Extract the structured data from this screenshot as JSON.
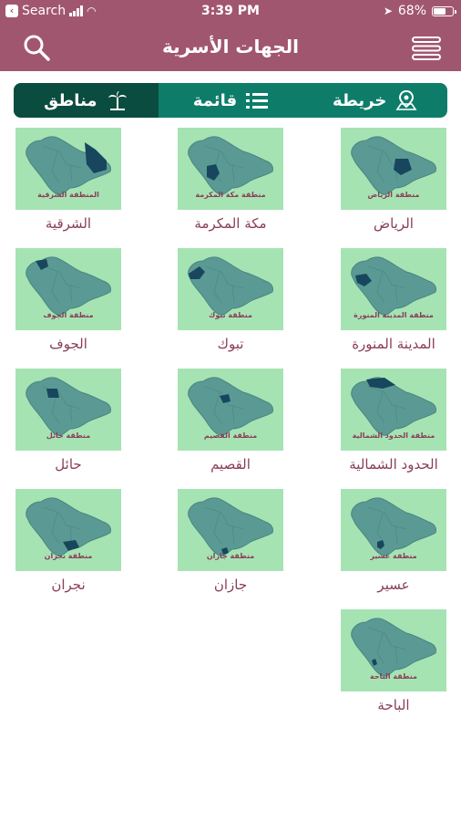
{
  "status_bar": {
    "back_label": "Search",
    "time": "3:39 PM",
    "battery": "68%",
    "battery_level": 0.68
  },
  "app_bar": {
    "title": "الجهات الأسرية",
    "icons": [
      "search-icon",
      "menu-icon"
    ]
  },
  "tabs": [
    {
      "label": "مناطق",
      "icon": "palm-tree-icon",
      "active": true
    },
    {
      "label": "قائمة",
      "icon": "list-icon",
      "active": false
    },
    {
      "label": "خريطة",
      "icon": "map-pin-icon",
      "active": false
    }
  ],
  "colors": {
    "brand": "#a1566f",
    "tab_bg": "#0d7d6a",
    "tab_active": "#0a4c3f",
    "map_bg": "#a6e3b3",
    "label": "#8a3d5a"
  },
  "regions": [
    {
      "name": "الرياض",
      "caption": "منطقة الرياض"
    },
    {
      "name": "مكة المكرمة",
      "caption": "منطقة مكة المكرمة"
    },
    {
      "name": "الشرقية",
      "caption": "المنطقة الشرقية"
    },
    {
      "name": "المدينة المنورة",
      "caption": "منطقة المدينة المنورة"
    },
    {
      "name": "تبوك",
      "caption": "منطقة تبوك"
    },
    {
      "name": "الجوف",
      "caption": "منطقة الجوف"
    },
    {
      "name": "الحدود الشمالية",
      "caption": "منطقة الحدود الشمالية"
    },
    {
      "name": "القصيم",
      "caption": "منطقة القصيم"
    },
    {
      "name": "حائل",
      "caption": "منطقة حائل"
    },
    {
      "name": "عسير",
      "caption": "منطقة عسير"
    },
    {
      "name": "جازان",
      "caption": "منطقة جازان"
    },
    {
      "name": "نجران",
      "caption": "منطقة نجران"
    },
    {
      "name": "الباحة",
      "caption": "منطقة الباحة"
    }
  ]
}
